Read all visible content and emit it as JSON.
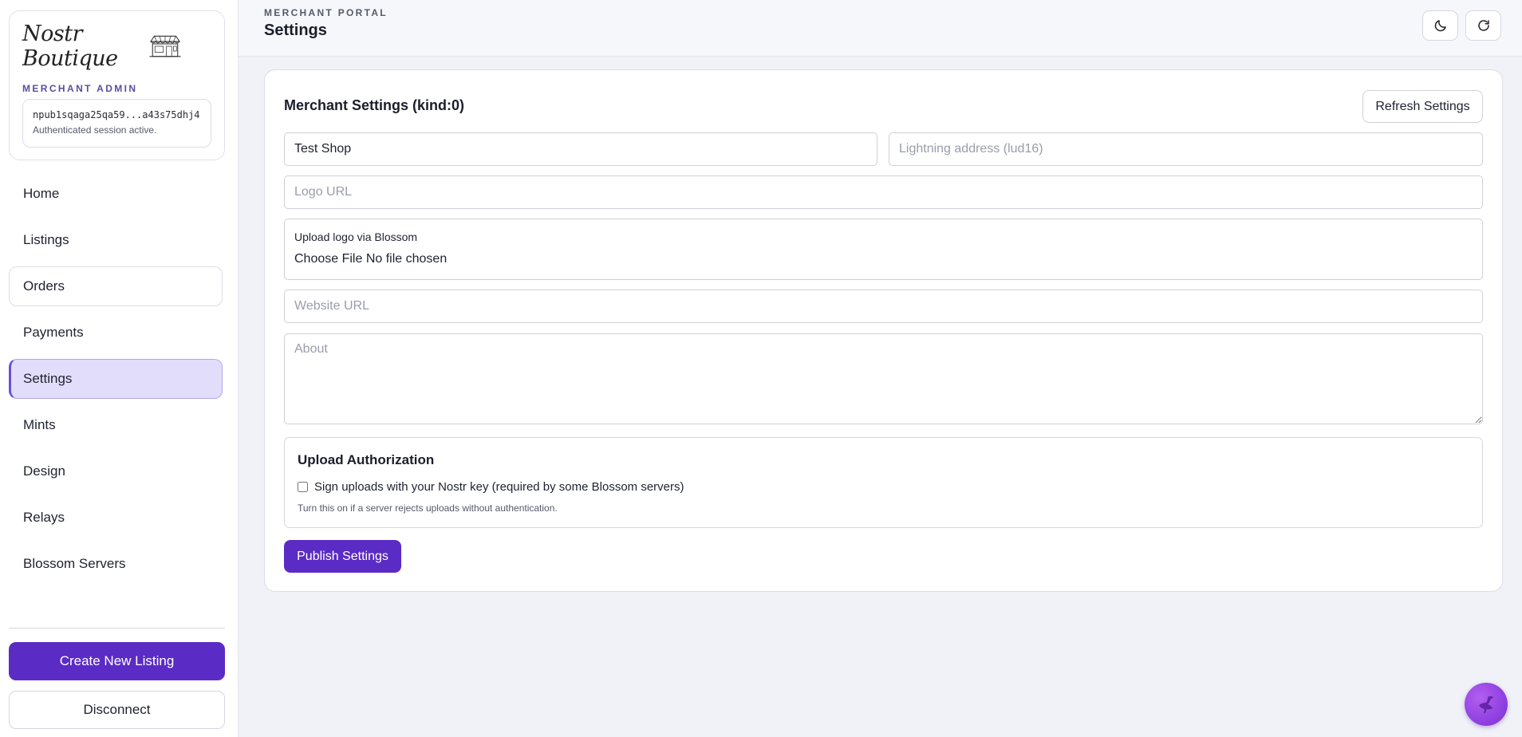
{
  "sidebar": {
    "logo_text": "Nostr Boutique",
    "subtitle": "MERCHANT ADMIN",
    "npub": "npub1sqaga25qa59...a43s75dhj4",
    "session_status": "Authenticated session active.",
    "nav": [
      {
        "label": "Home"
      },
      {
        "label": "Listings"
      },
      {
        "label": "Orders"
      },
      {
        "label": "Payments"
      },
      {
        "label": "Settings"
      },
      {
        "label": "Mints"
      },
      {
        "label": "Design"
      },
      {
        "label": "Relays"
      },
      {
        "label": "Blossom Servers"
      }
    ],
    "active_item": "Settings",
    "create_label": "Create New Listing",
    "disconnect_label": "Disconnect"
  },
  "header": {
    "section": "MERCHANT PORTAL",
    "title": "Settings",
    "icons": [
      "moon-icon",
      "refresh-icon"
    ]
  },
  "settings": {
    "title": "Merchant Settings (kind:0)",
    "refresh_label": "Refresh Settings",
    "shop_name_value": "Test Shop",
    "lightning_placeholder": "Lightning address (lud16)",
    "logo_url_placeholder": "Logo URL",
    "upload_label": "Upload logo via Blossom",
    "choose_file_label": "Choose File",
    "no_file_label": "No file chosen",
    "website_placeholder": "Website URL",
    "about_placeholder": "About",
    "auth": {
      "title": "Upload Authorization",
      "checkbox_label": "Sign uploads with your Nostr key (required by some Blossom servers)",
      "checked": false,
      "hint": "Turn this on if a server rejects uploads without authentication."
    },
    "publish_label": "Publish Settings"
  },
  "colors": {
    "accent": "#5b2bc5",
    "active_nav_bg": "#e2ddfb",
    "page_bg": "#f1f2f7"
  }
}
